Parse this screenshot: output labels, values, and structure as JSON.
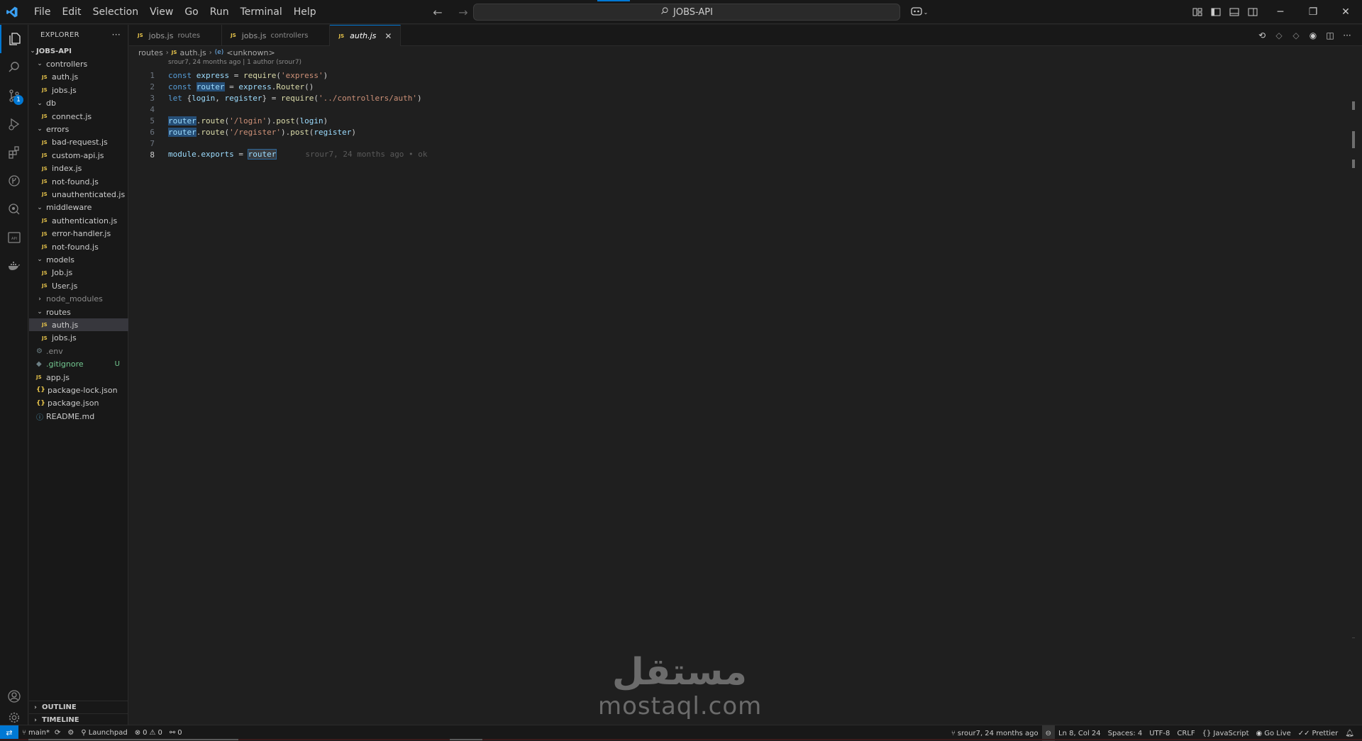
{
  "menu": [
    "File",
    "Edit",
    "Selection",
    "View",
    "Go",
    "Run",
    "Terminal",
    "Help"
  ],
  "search": {
    "label": "JOBS-API"
  },
  "explorer": {
    "header": "EXPLORER",
    "root": "JOBS-API",
    "tree": [
      {
        "label": "controllers",
        "kind": "folder",
        "open": true,
        "depth": 1
      },
      {
        "label": "auth.js",
        "kind": "js",
        "depth": 2
      },
      {
        "label": "jobs.js",
        "kind": "js",
        "depth": 2
      },
      {
        "label": "db",
        "kind": "folder",
        "open": true,
        "depth": 1
      },
      {
        "label": "connect.js",
        "kind": "js",
        "depth": 2
      },
      {
        "label": "errors",
        "kind": "folder",
        "open": true,
        "depth": 1
      },
      {
        "label": "bad-request.js",
        "kind": "js",
        "depth": 2
      },
      {
        "label": "custom-api.js",
        "kind": "js",
        "depth": 2
      },
      {
        "label": "index.js",
        "kind": "js",
        "depth": 2
      },
      {
        "label": "not-found.js",
        "kind": "js",
        "depth": 2
      },
      {
        "label": "unauthenticated.js",
        "kind": "js",
        "depth": 2
      },
      {
        "label": "middleware",
        "kind": "folder",
        "open": true,
        "depth": 1
      },
      {
        "label": "authentication.js",
        "kind": "js",
        "depth": 2
      },
      {
        "label": "error-handler.js",
        "kind": "js",
        "depth": 2
      },
      {
        "label": "not-found.js",
        "kind": "js",
        "depth": 2
      },
      {
        "label": "models",
        "kind": "folder",
        "open": true,
        "depth": 1
      },
      {
        "label": "Job.js",
        "kind": "js",
        "depth": 2
      },
      {
        "label": "User.js",
        "kind": "js",
        "depth": 2
      },
      {
        "label": "node_modules",
        "kind": "folder",
        "open": false,
        "depth": 1,
        "muted": true
      },
      {
        "label": "routes",
        "kind": "folder",
        "open": true,
        "depth": 1
      },
      {
        "label": "auth.js",
        "kind": "js",
        "depth": 2,
        "selected": true
      },
      {
        "label": "jobs.js",
        "kind": "js",
        "depth": 2
      },
      {
        "label": ".env",
        "kind": "env",
        "depth": 1,
        "muted": true
      },
      {
        "label": ".gitignore",
        "kind": "git",
        "depth": 1,
        "untracked": true,
        "badge": "U"
      },
      {
        "label": "app.js",
        "kind": "js",
        "depth": 1
      },
      {
        "label": "package-lock.json",
        "kind": "json",
        "depth": 1
      },
      {
        "label": "package.json",
        "kind": "json",
        "depth": 1
      },
      {
        "label": "README.md",
        "kind": "md",
        "depth": 1
      }
    ],
    "outline": "OUTLINE",
    "timeline": "TIMELINE"
  },
  "tabs": [
    {
      "name": "jobs.js",
      "desc": "routes",
      "active": false
    },
    {
      "name": "jobs.js",
      "desc": "controllers",
      "active": false
    },
    {
      "name": "auth.js",
      "desc": "",
      "active": true
    }
  ],
  "breadcrumb": [
    "routes",
    "auth.js",
    "<unknown>"
  ],
  "codelens": "srour7, 24 months ago | 1 author (srour7)",
  "code_lines": [
    "1",
    "2",
    "3",
    "4",
    "5",
    "6",
    "7",
    "8"
  ],
  "code": {
    "l1": [
      "const",
      " express",
      " = ",
      "require",
      "(",
      "'express'",
      ")"
    ],
    "l2": [
      "const",
      " ",
      "router",
      " = ",
      "express",
      ".",
      "Router",
      "()"
    ],
    "l3": [
      "let",
      " {",
      "login",
      ", ",
      "register",
      "} = ",
      "require",
      "(",
      "'../controllers/auth'",
      ")"
    ],
    "l5": [
      "router",
      ".",
      "route",
      "(",
      "'/login'",
      ").",
      "post",
      "(",
      "login",
      ")"
    ],
    "l6": [
      "router",
      ".",
      "route",
      "(",
      "'/register'",
      ").",
      "post",
      "(",
      "register",
      ")"
    ],
    "l8": [
      "module",
      ".",
      "exports",
      " = ",
      "router"
    ],
    "blame": "srour7, 24 months ago • ok"
  },
  "watermark": {
    "arabic": "مستقل",
    "latin": "mostaql.com"
  },
  "status": {
    "branch": "main*",
    "launchpad": "Launchpad",
    "errors": "0",
    "warnings": "0",
    "ports": "0",
    "blame": "srour7, 24 months ago",
    "position": "Ln 8, Col 24",
    "spaces": "Spaces: 4",
    "encoding": "UTF-8",
    "eol": "CRLF",
    "language": "JavaScript",
    "golive": "Go Live",
    "prettier": "Prettier"
  },
  "colors": {
    "accent": "#0078d4",
    "bg": "#1f1f1f",
    "sidebar": "#181818"
  }
}
